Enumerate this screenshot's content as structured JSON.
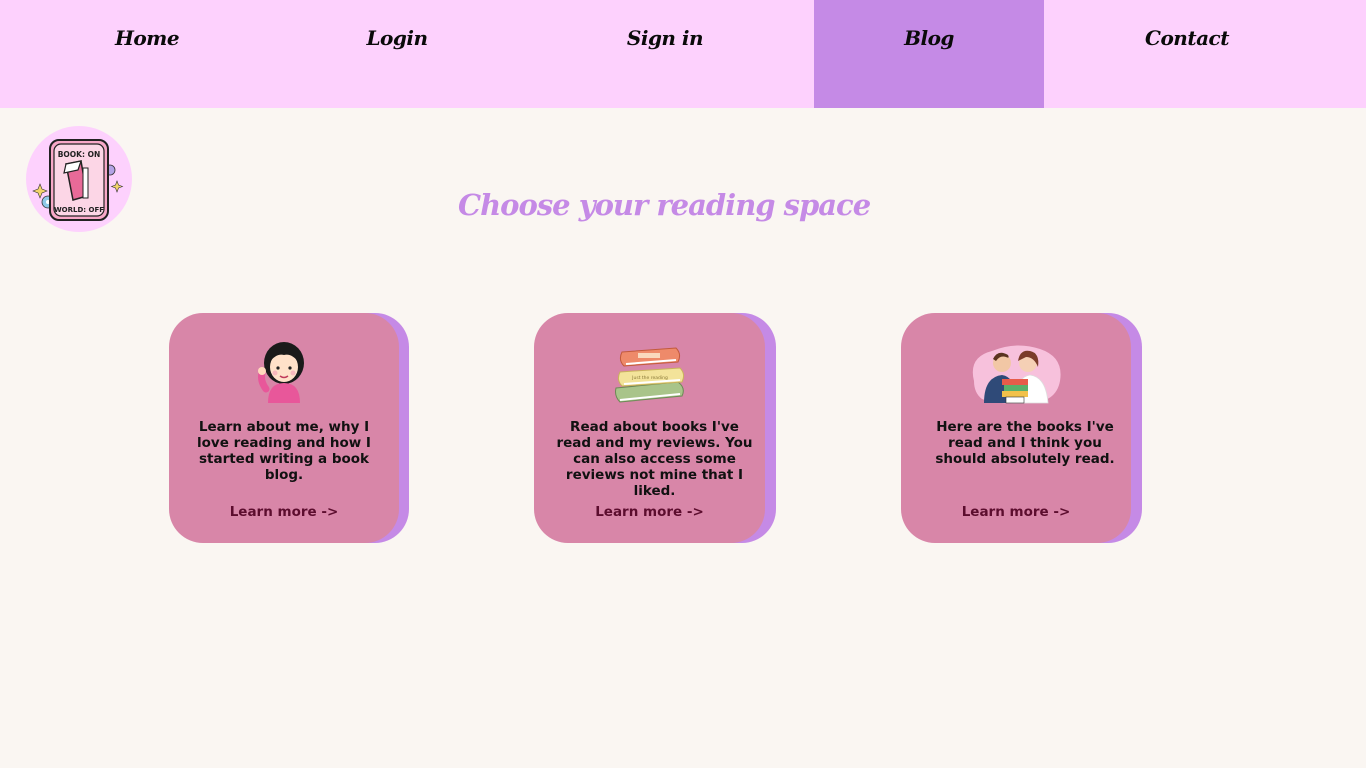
{
  "nav": {
    "items": [
      {
        "label": "Home"
      },
      {
        "label": "Login"
      },
      {
        "label": "Sign in"
      },
      {
        "label": "Blog",
        "active": true
      },
      {
        "label": "Contact"
      }
    ]
  },
  "logo": {
    "top_text": "BOOK: ON",
    "bottom_text": "WORLD: OFF",
    "icon": "light-switch-logo"
  },
  "heading": "Choose your reading space",
  "cards": [
    {
      "icon": "girl-waving-illustration",
      "text": "Learn about me, why I love reading and how I started writing a book blog.",
      "link": "Learn more ->"
    },
    {
      "icon": "book-stack-illustration",
      "text": "Read about books I've read and my reviews. You can also access some reviews not mine that I liked.",
      "link": "Learn more ->",
      "book_spine_text": "Just the reading"
    },
    {
      "icon": "couple-reading-illustration",
      "text": "Here are the books I've read and I think you should absolutely read.",
      "link": "Learn more ->"
    }
  ],
  "colors": {
    "nav_bg": "#fdd1fd",
    "nav_active": "#c58ae6",
    "page_bg": "#faf6f2",
    "card_bg": "#d886a8",
    "card_shadow": "#c58ae6",
    "heading": "#c58ae6",
    "link": "#5c0d2e"
  }
}
